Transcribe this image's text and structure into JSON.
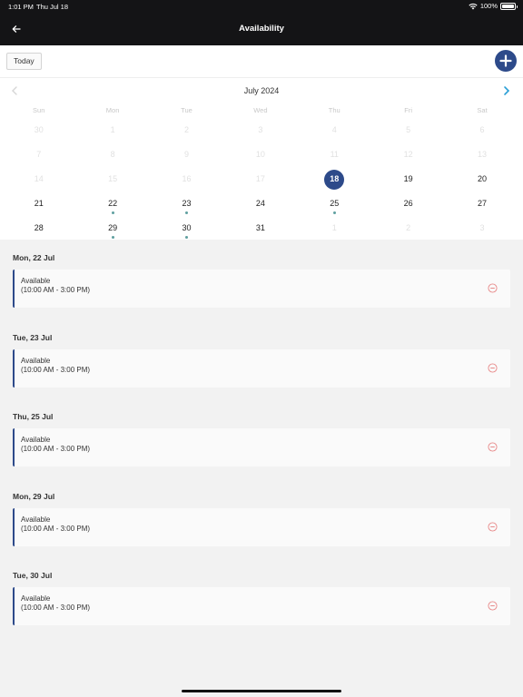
{
  "status_bar": {
    "time": "1:01 PM",
    "date": "Thu Jul 18",
    "battery": "100%"
  },
  "header": {
    "title": "Availability"
  },
  "toolbar": {
    "today_label": "Today"
  },
  "calendar": {
    "month_title": "July 2024",
    "weekdays": [
      "Sun",
      "Mon",
      "Tue",
      "Wed",
      "Thu",
      "Fri",
      "Sat"
    ],
    "weeks": [
      [
        "30",
        "1",
        "2",
        "3",
        "4",
        "5",
        "6"
      ],
      [
        "7",
        "8",
        "9",
        "10",
        "11",
        "12",
        "13"
      ],
      [
        "14",
        "15",
        "16",
        "17",
        "18",
        "19",
        "20"
      ],
      [
        "21",
        "22",
        "23",
        "24",
        "25",
        "26",
        "27"
      ],
      [
        "28",
        "29",
        "30",
        "31",
        "1",
        "2",
        "3"
      ]
    ],
    "selected_day": "18"
  },
  "availability": [
    {
      "date": "Mon, 22 Jul",
      "status": "Available",
      "time": "(10:00 AM - 3:00 PM)"
    },
    {
      "date": "Tue, 23 Jul",
      "status": "Available",
      "time": "(10:00 AM - 3:00 PM)"
    },
    {
      "date": "Thu, 25 Jul",
      "status": "Available",
      "time": "(10:00 AM - 3:00 PM)"
    },
    {
      "date": "Mon, 29 Jul",
      "status": "Available",
      "time": "(10:00 AM - 3:00 PM)"
    },
    {
      "date": "Tue, 30 Jul",
      "status": "Available",
      "time": "(10:00 AM - 3:00 PM)"
    }
  ],
  "colors": {
    "accent": "#2d4a8a",
    "nav_bg": "#141416",
    "remove": "#e88a8a",
    "next_arrow": "#2a9fd6",
    "dot": "#5fa0a0"
  },
  "icons": {
    "back": "arrow-left-icon",
    "add": "plus-icon",
    "prev": "chevron-left-icon",
    "next": "chevron-right-icon",
    "remove": "minus-circle-icon"
  }
}
